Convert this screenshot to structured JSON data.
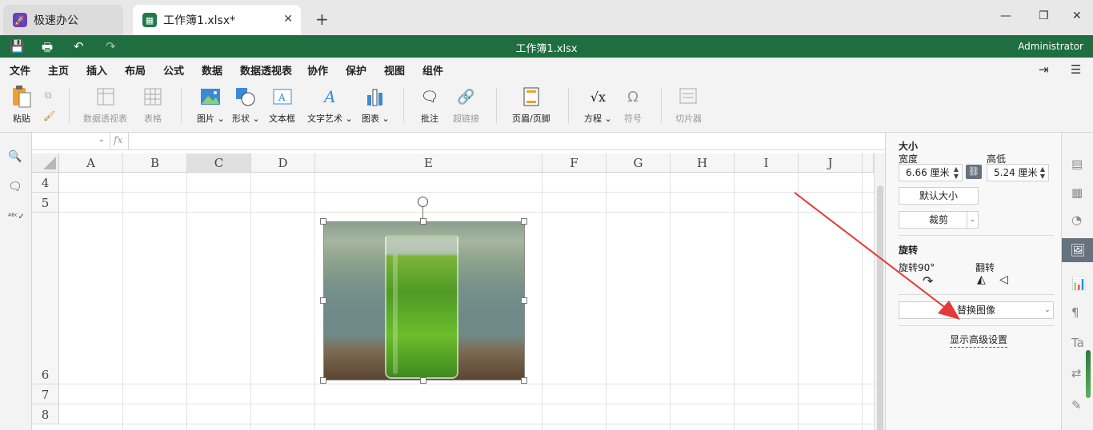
{
  "tabs": [
    {
      "label": "极速办公",
      "icon": "rocket-icon",
      "icon_color": "#6a3fbf"
    },
    {
      "label": "工作簿1.xlsx*",
      "icon": "spreadsheet-icon",
      "icon_color": "#1e7a46"
    }
  ],
  "window_title": "工作簿1.xlsx",
  "user": "Administrator",
  "menu": [
    "文件",
    "主页",
    "插入",
    "布局",
    "公式",
    "数据",
    "数据透视表",
    "协作",
    "保护",
    "视图",
    "组件"
  ],
  "active_menu": "插入",
  "ribbon": {
    "paste": "粘贴",
    "pivot": "数据透视表",
    "table": "表格",
    "picture": "图片",
    "shape": "形状",
    "textbox": "文本框",
    "wordart": "文字艺术",
    "chart": "图表",
    "comment": "批注",
    "hyperlink": "超链接",
    "header_footer": "页眉/页脚",
    "equation": "方程",
    "symbol": "符号",
    "slicer": "切片器"
  },
  "formula": {
    "fx": "fx"
  },
  "columns": [
    "A",
    "B",
    "C",
    "D",
    "E",
    "F",
    "G",
    "H",
    "I",
    "J"
  ],
  "rows": [
    "4",
    "5",
    "6",
    "7",
    "8"
  ],
  "panel": {
    "size_title": "大小",
    "width_label": "宽度",
    "height_label": "高低",
    "width_value": "6.66 厘米",
    "height_value": "5.24 厘米",
    "default_size": "默认大小",
    "crop": "裁剪",
    "rotate_title": "旋转",
    "rotate90": "旋转90°",
    "flip": "翻转",
    "replace_image": "替换图像",
    "advanced": "显示高级设置"
  },
  "colors": {
    "brand": "#1e6e3f",
    "arrow": "#e53935",
    "panel_active": "#66727e"
  }
}
